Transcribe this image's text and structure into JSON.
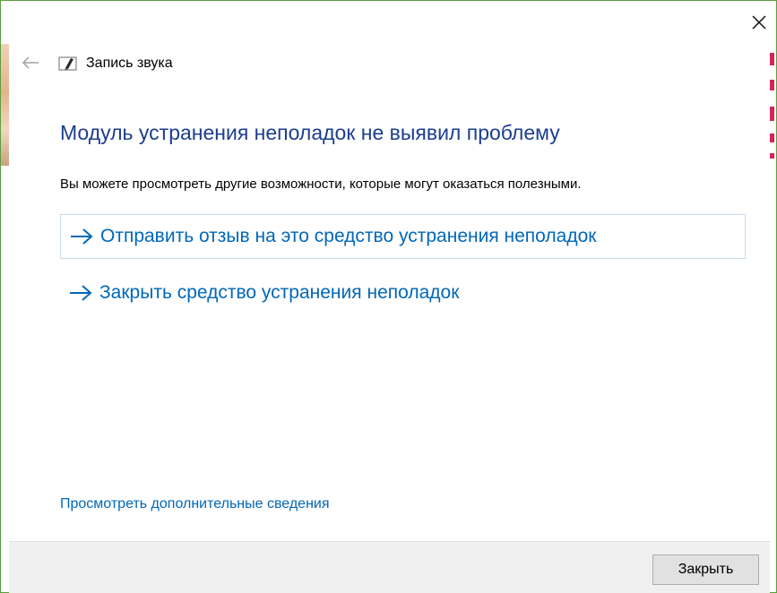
{
  "window": {
    "title": "Запись звука",
    "close_icon": "close-icon",
    "back_icon": "back-arrow-icon",
    "app_icon": "sound-recorder-icon"
  },
  "main": {
    "heading": "Модуль устранения неполадок не выявил проблему",
    "subtext": "Вы можете просмотреть другие возможности, которые могут оказаться полезными.",
    "options": [
      {
        "label": "Отправить отзыв на это средство устранения неполадок",
        "icon": "arrow-right-icon"
      },
      {
        "label": "Закрыть средство устранения неполадок",
        "icon": "arrow-right-icon"
      }
    ],
    "more_info_link": "Просмотреть дополнительные сведения"
  },
  "footer": {
    "close_button": "Закрыть"
  },
  "colors": {
    "heading": "#1c3d8f",
    "link": "#0067b8",
    "footer_bg": "#f0f0f0",
    "window_border": "#5a9f3e"
  }
}
